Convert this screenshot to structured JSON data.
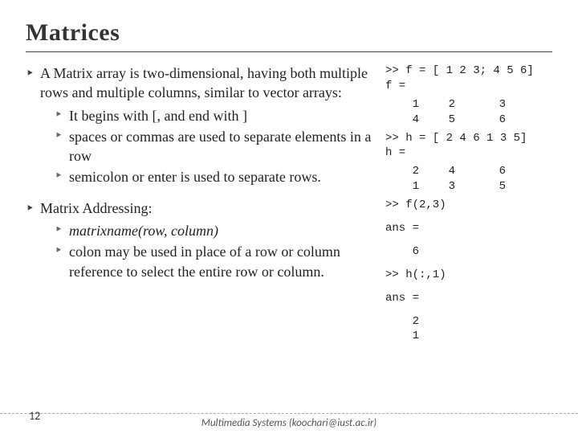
{
  "title": "Matrices",
  "bullets": {
    "b1": "A Matrix array is two-dimensional, having both multiple rows and multiple columns, similar to vector arrays:",
    "b1a": "It begins with [, and end with ]",
    "b1b": "spaces or commas are used to separate elements in a row",
    "b1c": "semicolon or enter is used to separate rows.",
    "b2": "Matrix Addressing:",
    "b2a": "matrixname(row, column)",
    "b2b": "colon may be used in place of a row or column reference to select the entire row or column."
  },
  "code": {
    "l1": ">> f = [ 1 2 3; 4 5 6]",
    "l2": "f =",
    "f": [
      [
        "1",
        "2",
        "3"
      ],
      [
        "4",
        "5",
        "6"
      ]
    ],
    "l3": ">> h = [ 2 4 6 1 3 5]",
    "l4": "h =",
    "h": [
      [
        "2",
        "4",
        "6"
      ],
      [
        "1",
        "3",
        "5"
      ]
    ],
    "l5": ">> f(2,3)",
    "l6": "ans =",
    "ans1": "6",
    "l7": ">> h(:,1)",
    "l8": "ans =",
    "ans2": [
      "2",
      "1"
    ]
  },
  "footer": {
    "page": "12",
    "text": "Multimedia Systems (koochari@iust.ac.ir)"
  },
  "chart_data": {
    "type": "table",
    "title": "MATLAB matrix examples",
    "matrices": [
      {
        "name": "f",
        "rows": [
          [
            1,
            2,
            3
          ],
          [
            4,
            5,
            6
          ]
        ],
        "defined_by": "f = [ 1 2 3; 4 5 6]"
      },
      {
        "name": "h",
        "rows": [
          [
            2,
            4,
            6
          ],
          [
            1,
            3,
            5
          ]
        ],
        "defined_by": "h = [ 2 4 6 1 3 5]"
      }
    ],
    "expressions": [
      {
        "expr": "f(2,3)",
        "result": 6
      },
      {
        "expr": "h(:,1)",
        "result": [
          2,
          1
        ]
      }
    ]
  }
}
